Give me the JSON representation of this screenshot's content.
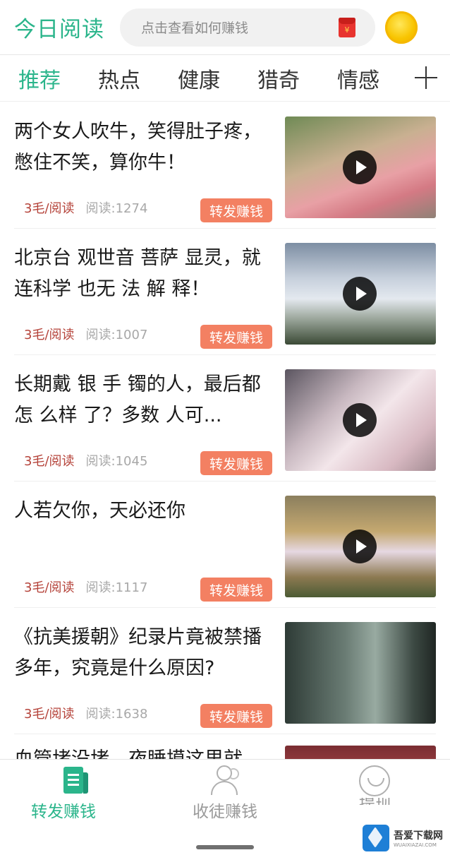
{
  "header": {
    "title": "今日阅读",
    "search_placeholder": "点击查看如何赚钱",
    "redpacket_glyph": "¥",
    "icons": {
      "redpacket": "red-packet-icon",
      "coin": "gold-coin-icon"
    },
    "colors": {
      "brand": "#2bb58b",
      "redpacket": "#e8342f",
      "coin": "#f8c400"
    }
  },
  "tabs": {
    "items": [
      {
        "label": "推荐",
        "active": true
      },
      {
        "label": "热点",
        "active": false
      },
      {
        "label": "健康",
        "active": false
      },
      {
        "label": "猎奇",
        "active": false
      },
      {
        "label": "情感",
        "active": false
      }
    ],
    "add_icon": "plus-icon"
  },
  "feed": {
    "items": [
      {
        "title": "两个女人吹牛，笑得肚子疼，憋住不笑，算你牛！",
        "price": "3毛/阅读",
        "reads": "阅读:1274",
        "share_label": "转发赚钱",
        "has_video": true
      },
      {
        "title": "北京台 观世音 菩萨 显灵，就连科学 也无 法 解 释！",
        "price": "3毛/阅读",
        "reads": "阅读:1007",
        "share_label": "转发赚钱",
        "has_video": true
      },
      {
        "title": "长期戴 银 手 镯的人，最后都怎 么样 了？多数 人可...",
        "price": "3毛/阅读",
        "reads": "阅读:1045",
        "share_label": "转发赚钱",
        "has_video": true
      },
      {
        "title": "人若欠你，天必还你",
        "price": "3毛/阅读",
        "reads": "阅读:1117",
        "share_label": "转发赚钱",
        "has_video": true
      },
      {
        "title": "《抗美援朝》纪录片竟被禁播多年，究竟是什么原因?",
        "price": "3毛/阅读",
        "reads": "阅读:1638",
        "share_label": "转发赚钱",
        "has_video": false
      },
      {
        "title": "血管堵没堵，夜睡摸这里就"
      }
    ],
    "colors": {
      "share_button": "#f38062",
      "price": "#b5433a"
    }
  },
  "bottom_nav": {
    "items": [
      {
        "label": "转发赚钱",
        "icon": "news-icon",
        "active": true
      },
      {
        "label": "收徒赚钱",
        "icon": "people-icon",
        "active": false
      },
      {
        "label": "提现",
        "icon": "smile-icon",
        "active": false
      }
    ]
  },
  "watermark": {
    "name": "吾爱下载网",
    "url": "WUAIXIAZAI.COM"
  }
}
